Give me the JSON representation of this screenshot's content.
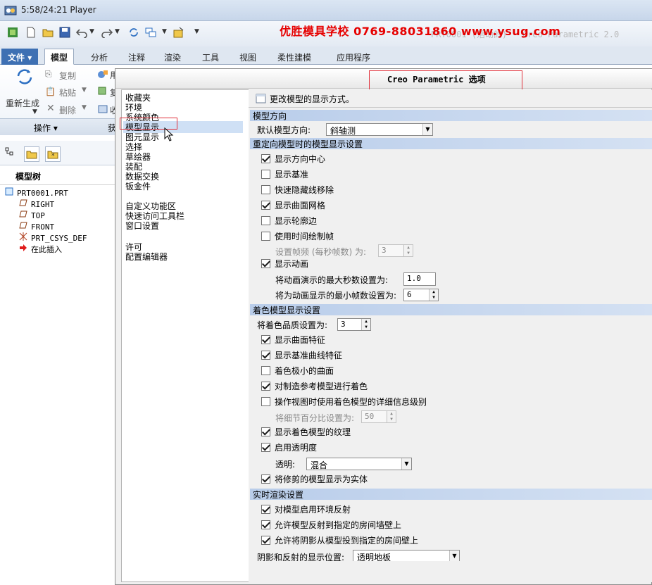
{
  "titlebar": {
    "title": "5:58/24:21 Player"
  },
  "banner": {
    "text": "优胜模具学校 0769-88031860 www.ysug.com"
  },
  "window_title": "PRT0001 (活动的) - Creo Parametric 2.0",
  "ribbon_tabs": [
    "文件",
    "模型",
    "分析",
    "注释",
    "渲染",
    "工具",
    "视图",
    "柔性建模",
    "应用程序"
  ],
  "ribbon": {
    "regenerate": "重新生成",
    "copy": "复制",
    "paste": "粘贴",
    "delete": "删除",
    "group_operations": "操作",
    "partial_1": "用",
    "partial_2": "复",
    "partial_3": "收",
    "partial_group": "获"
  },
  "tree": {
    "header": "模型树",
    "items": [
      "PRT0001.PRT",
      "RIGHT",
      "TOP",
      "FRONT",
      "PRT_CSYS_DEF",
      "在此插入"
    ]
  },
  "dialog": {
    "title": "Creo Parametric 选项",
    "nav_group1": [
      "收藏夹",
      "环境",
      "系统颜色",
      "模型显示",
      "图元显示",
      "选择",
      "草绘器",
      "装配",
      "数据交换",
      "钣金件"
    ],
    "nav_group2": [
      "自定义功能区",
      "快速访问工具栏",
      "窗口设置"
    ],
    "nav_group3": [
      "许可",
      "配置编辑器"
    ],
    "top_option": "更改模型的显示方式。",
    "sections": {
      "orientation": "模型方向",
      "reorient": "重定向模型时的模型显示设置",
      "shaded": "着色模型显示设置",
      "realtime": "实时渲染设置"
    },
    "orientation_label": "默认模型方向:",
    "orientation_value": "斜轴测",
    "reorient_options": [
      "显示方向中心",
      "显示基准",
      "快速隐藏线移除",
      "显示曲面网格",
      "显示轮廓边",
      "使用时间绘制帧"
    ],
    "frame_rate_label": "设置帧频 (每秒帧数) 为:",
    "frame_rate_value": "3",
    "show_animation": "显示动画",
    "anim_max_seconds_label": "将动画演示的最大秒数设置为:",
    "anim_max_seconds_value": "1.0",
    "anim_min_frames_label": "将为动画显示的最小帧数设置为:",
    "anim_min_frames_value": "6",
    "shade_quality_label": "将着色品质设置为:",
    "shade_quality_value": "3",
    "shaded_options": [
      "显示曲面特征",
      "显示基准曲线特征",
      "着色极小的曲面",
      "对制造参考模型进行着色",
      "操作视图时使用着色模型的详细信息级别"
    ],
    "detail_pct_label": "将细节百分比设置为:",
    "detail_pct_value": "50",
    "texture_option": "显示着色模型的纹理",
    "transparency_option": "启用透明度",
    "transparency_label": "透明:",
    "transparency_value": "混合",
    "trimmed_solid_option": "将修剪的模型显示为实体",
    "realtime_options": [
      "对模型启用环境反射",
      "允许模型反射到指定的房间墙壁上",
      "允许将阴影从模型投到指定的房间壁上"
    ],
    "shadow_pos_label": "阴影和反射的显示位置:",
    "shadow_pos_value": "透明地板"
  }
}
